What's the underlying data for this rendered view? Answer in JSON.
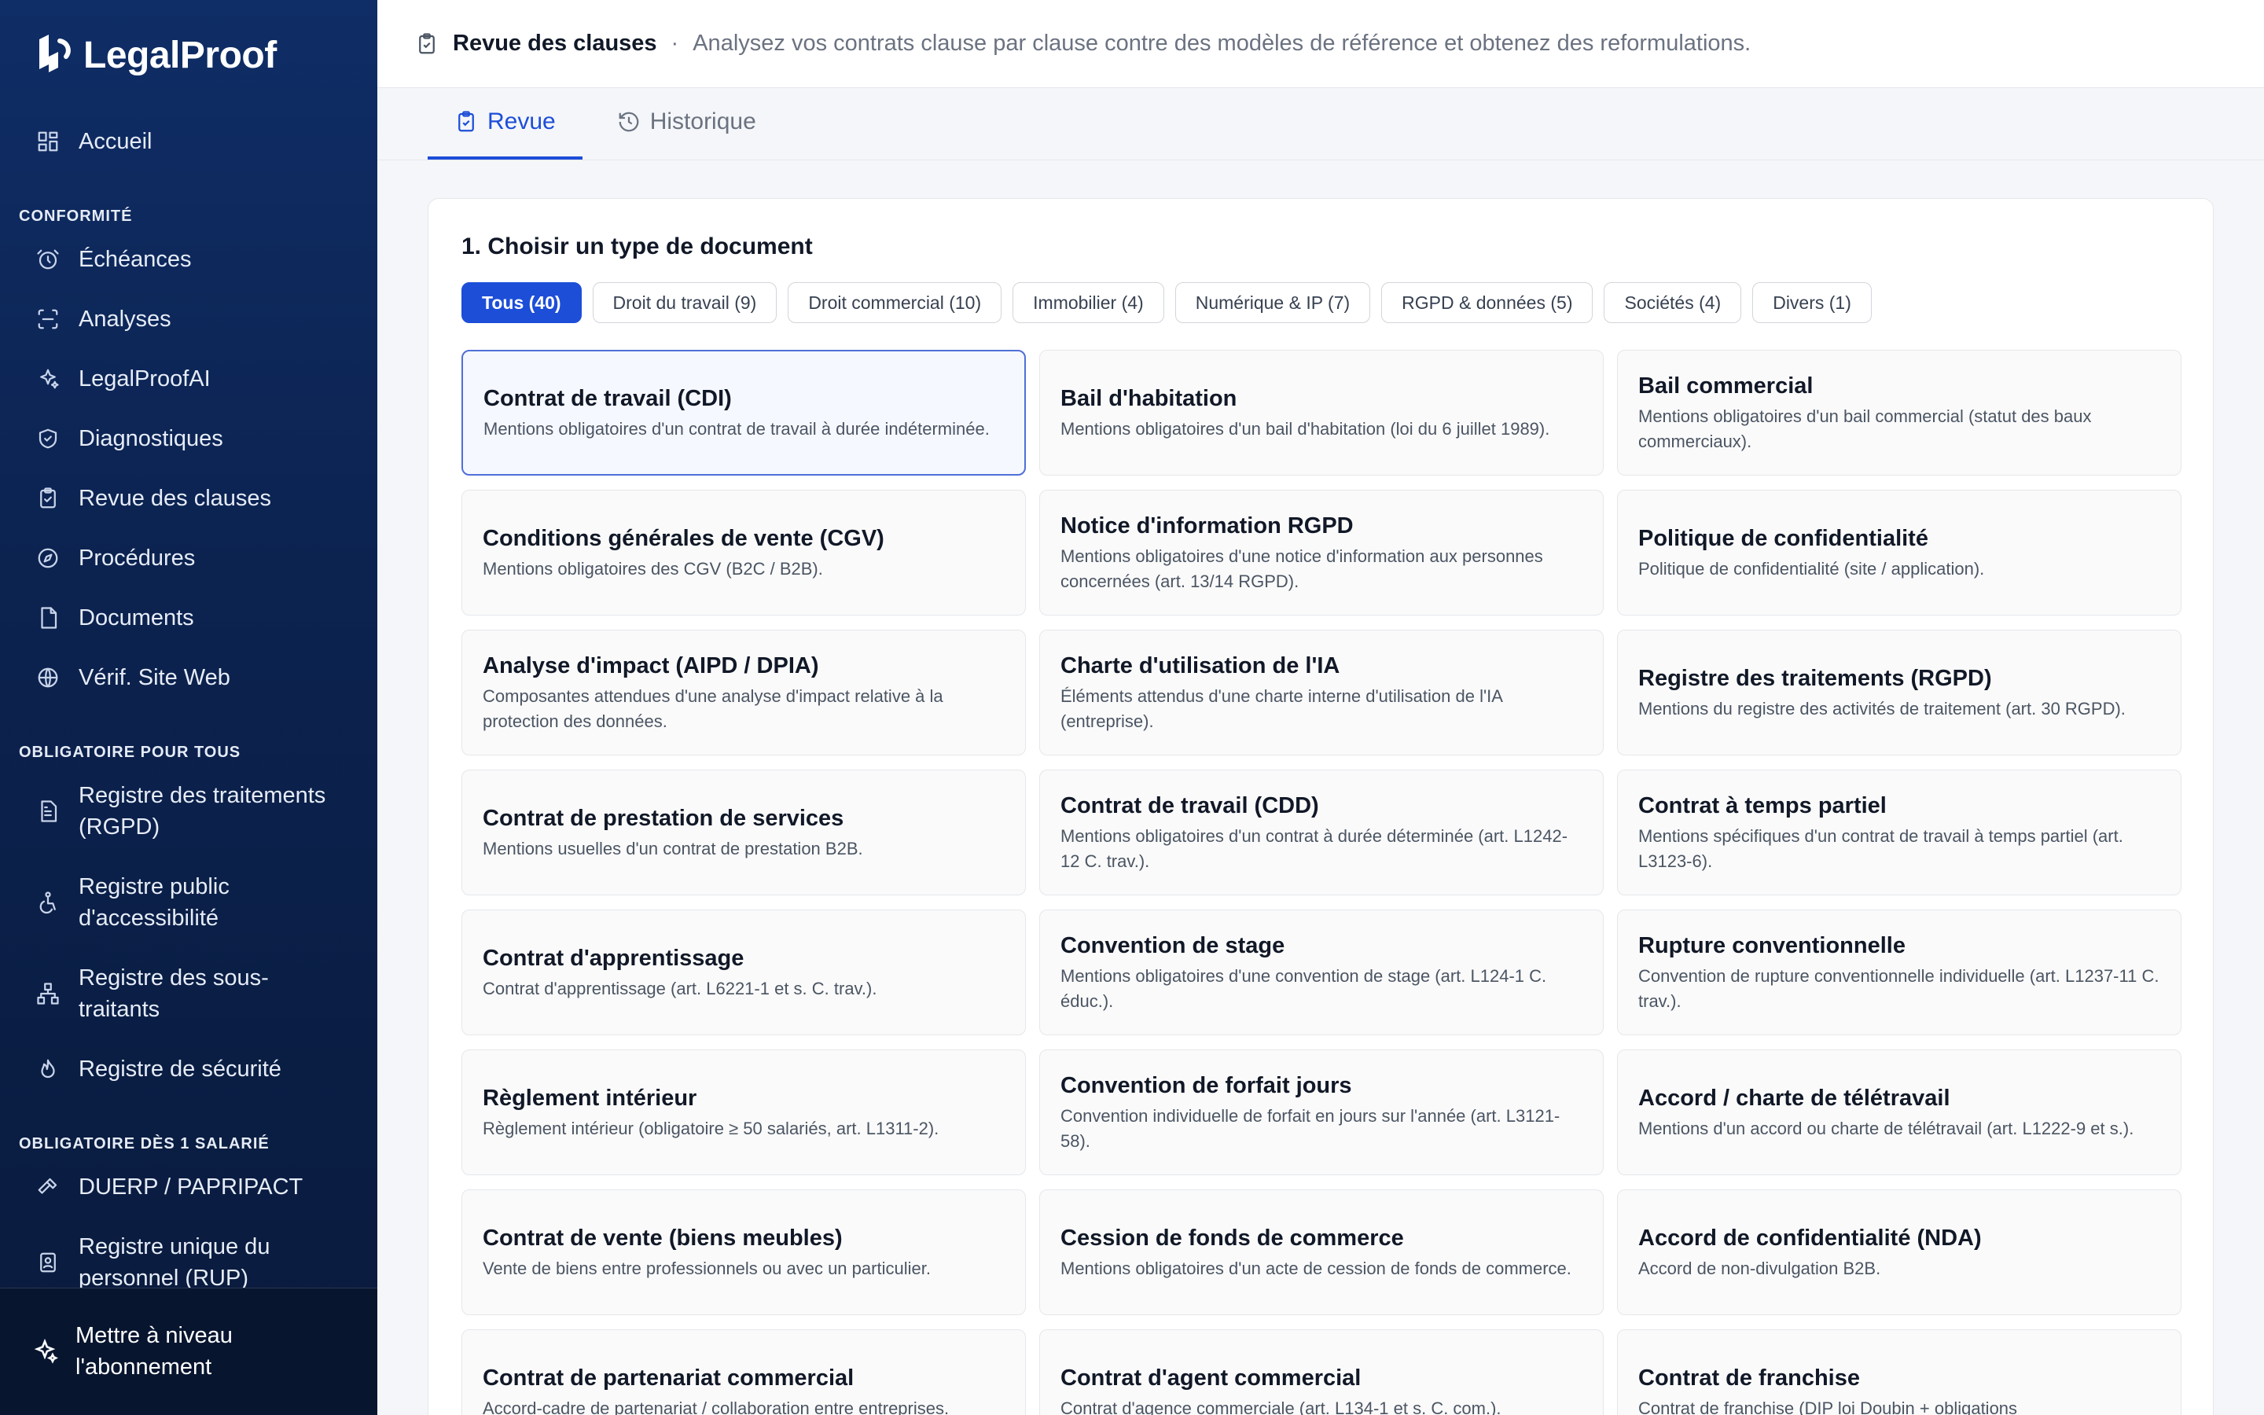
{
  "app": {
    "name": "LegalProof"
  },
  "sidebar": {
    "home": {
      "label": "Accueil"
    },
    "sections": [
      {
        "title": "CONFORMITÉ",
        "items": [
          {
            "label": "Échéances",
            "icon": "alarm-icon"
          },
          {
            "label": "Analyses",
            "icon": "scan-icon"
          },
          {
            "label": "LegalProofAI",
            "icon": "sparkles-icon"
          },
          {
            "label": "Diagnostiques",
            "icon": "shield-check-icon"
          },
          {
            "label": "Revue des clauses",
            "icon": "clipboard-check-icon"
          },
          {
            "label": "Procédures",
            "icon": "compass-icon"
          },
          {
            "label": "Documents",
            "icon": "file-icon"
          },
          {
            "label": "Vérif. Site Web",
            "icon": "globe-icon"
          }
        ]
      },
      {
        "title": "OBLIGATOIRE POUR TOUS",
        "items": [
          {
            "label": "Registre des traitements (RGPD)",
            "icon": "file-text-icon"
          },
          {
            "label": "Registre public d'accessibilité",
            "icon": "accessibility-icon"
          },
          {
            "label": "Registre des sous-traitants",
            "icon": "network-icon"
          },
          {
            "label": "Registre de sécurité",
            "icon": "flame-icon"
          }
        ]
      },
      {
        "title": "OBLIGATOIRE DÈS 1 SALARIÉ",
        "items": [
          {
            "label": "DUERP / PAPRIPACT",
            "icon": "hammer-icon"
          },
          {
            "label": "Registre unique du personnel (RUP)",
            "icon": "id-badge-icon"
          }
        ]
      }
    ],
    "upgrade": {
      "label": "Mettre à niveau l'abonnement"
    }
  },
  "header": {
    "title": "Revue des clauses",
    "separator": "·",
    "subtitle": "Analysez vos contrats clause par clause contre des modèles de référence et obtenez des reformulations."
  },
  "tabs": [
    {
      "label": "Revue",
      "active": true
    },
    {
      "label": "Historique",
      "active": false
    }
  ],
  "step": {
    "title": "1. Choisir un type de document"
  },
  "filters": [
    {
      "label": "Tous (40)",
      "active": true
    },
    {
      "label": "Droit du travail (9)",
      "active": false
    },
    {
      "label": "Droit commercial (10)",
      "active": false
    },
    {
      "label": "Immobilier (4)",
      "active": false
    },
    {
      "label": "Numérique & IP (7)",
      "active": false
    },
    {
      "label": "RGPD & données (5)",
      "active": false
    },
    {
      "label": "Sociétés (4)",
      "active": false
    },
    {
      "label": "Divers (1)",
      "active": false
    }
  ],
  "documents": [
    {
      "title": "Contrat de travail (CDI)",
      "desc": "Mentions obligatoires d'un contrat de travail à durée indéterminée.",
      "selected": true
    },
    {
      "title": "Bail d'habitation",
      "desc": "Mentions obligatoires d'un bail d'habitation (loi du 6 juillet 1989)."
    },
    {
      "title": "Bail commercial",
      "desc": "Mentions obligatoires d'un bail commercial (statut des baux commerciaux)."
    },
    {
      "title": "Conditions générales de vente (CGV)",
      "desc": "Mentions obligatoires des CGV (B2C / B2B)."
    },
    {
      "title": "Notice d'information RGPD",
      "desc": "Mentions obligatoires d'une notice d'information aux personnes concernées (art. 13/14 RGPD)."
    },
    {
      "title": "Politique de confidentialité",
      "desc": "Politique de confidentialité (site / application)."
    },
    {
      "title": "Analyse d'impact (AIPD / DPIA)",
      "desc": "Composantes attendues d'une analyse d'impact relative à la protection des données."
    },
    {
      "title": "Charte d'utilisation de l'IA",
      "desc": "Éléments attendus d'une charte interne d'utilisation de l'IA (entreprise)."
    },
    {
      "title": "Registre des traitements (RGPD)",
      "desc": "Mentions du registre des activités de traitement (art. 30 RGPD)."
    },
    {
      "title": "Contrat de prestation de services",
      "desc": "Mentions usuelles d'un contrat de prestation B2B."
    },
    {
      "title": "Contrat de travail (CDD)",
      "desc": "Mentions obligatoires d'un contrat à durée déterminée (art. L1242-12 C. trav.)."
    },
    {
      "title": "Contrat à temps partiel",
      "desc": "Mentions spécifiques d'un contrat de travail à temps partiel (art. L3123-6)."
    },
    {
      "title": "Contrat d'apprentissage",
      "desc": "Contrat d'apprentissage (art. L6221-1 et s. C. trav.)."
    },
    {
      "title": "Convention de stage",
      "desc": "Mentions obligatoires d'une convention de stage (art. L124-1 C. éduc.)."
    },
    {
      "title": "Rupture conventionnelle",
      "desc": "Convention de rupture conventionnelle individuelle (art. L1237-11 C. trav.)."
    },
    {
      "title": "Règlement intérieur",
      "desc": "Règlement intérieur (obligatoire ≥ 50 salariés, art. L1311-2)."
    },
    {
      "title": "Convention de forfait jours",
      "desc": "Convention individuelle de forfait en jours sur l'année (art. L3121-58)."
    },
    {
      "title": "Accord / charte de télétravail",
      "desc": "Mentions d'un accord ou charte de télétravail (art. L1222-9 et s.)."
    },
    {
      "title": "Contrat de vente (biens meubles)",
      "desc": "Vente de biens entre professionnels ou avec un particulier."
    },
    {
      "title": "Cession de fonds de commerce",
      "desc": "Mentions obligatoires d'un acte de cession de fonds de commerce."
    },
    {
      "title": "Accord de confidentialité (NDA)",
      "desc": "Accord de non-divulgation B2B."
    },
    {
      "title": "Contrat de partenariat commercial",
      "desc": "Accord-cadre de partenariat / collaboration entre entreprises."
    },
    {
      "title": "Contrat d'agent commercial",
      "desc": "Contrat d'agence commerciale (art. L134-1 et s. C. com.)."
    },
    {
      "title": "Contrat de franchise",
      "desc": "Contrat de franchise (DIP loi Doubin + obligations"
    }
  ]
}
